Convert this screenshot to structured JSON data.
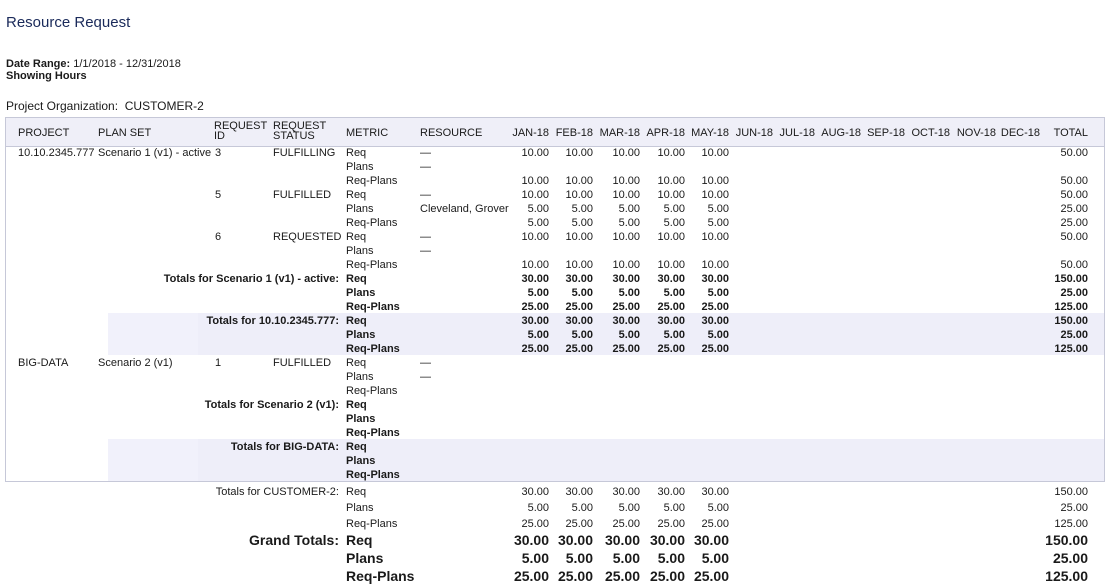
{
  "page": {
    "title": "Resource Request",
    "date_range_label": "Date Range:",
    "date_range_value": "1/1/2018 - 12/31/2018",
    "showing": "Showing Hours",
    "org_label": "Project Organization:",
    "org_value": "CUSTOMER-2"
  },
  "columns": {
    "project": "PROJECT",
    "plan_set": "PLAN SET",
    "request_id": [
      "REQUEST",
      "ID"
    ],
    "request_status": [
      "REQUEST",
      "STATUS"
    ],
    "metric": "METRIC",
    "resource": "RESOURCE",
    "months": [
      "JAN-18",
      "FEB-18",
      "MAR-18",
      "APR-18",
      "MAY-18",
      "JUN-18",
      "JUL-18",
      "AUG-18",
      "SEP-18",
      "OCT-18",
      "NOV-18",
      "DEC-18"
    ],
    "total": "TOTAL"
  },
  "rows": [
    {
      "kind": "data",
      "project": "10.10.2345.777",
      "plan_set": "Scenario 1 (v1) - active",
      "request_id": "3",
      "status": "FULFILLING",
      "metric": "Req",
      "resource": "—",
      "values": [
        "10.00",
        "10.00",
        "10.00",
        "10.00",
        "10.00"
      ],
      "total": "50.00"
    },
    {
      "kind": "data",
      "metric": "Plans",
      "resource": "—",
      "values": [],
      "total": ""
    },
    {
      "kind": "data",
      "metric": "Req-Plans",
      "values": [
        "10.00",
        "10.00",
        "10.00",
        "10.00",
        "10.00"
      ],
      "total": "50.00"
    },
    {
      "kind": "data",
      "request_id": "5",
      "status": "FULFILLED",
      "metric": "Req",
      "resource": "—",
      "values": [
        "10.00",
        "10.00",
        "10.00",
        "10.00",
        "10.00"
      ],
      "total": "50.00"
    },
    {
      "kind": "data",
      "metric": "Plans",
      "resource": "Cleveland, Grover",
      "values": [
        "5.00",
        "5.00",
        "5.00",
        "5.00",
        "5.00"
      ],
      "total": "25.00"
    },
    {
      "kind": "data",
      "metric": "Req-Plans",
      "values": [
        "5.00",
        "5.00",
        "5.00",
        "5.00",
        "5.00"
      ],
      "total": "25.00"
    },
    {
      "kind": "data",
      "request_id": "6",
      "status": "REQUESTED",
      "metric": "Req",
      "resource": "—",
      "values": [
        "10.00",
        "10.00",
        "10.00",
        "10.00",
        "10.00"
      ],
      "total": "50.00"
    },
    {
      "kind": "data",
      "metric": "Plans",
      "resource": "—",
      "values": [],
      "total": ""
    },
    {
      "kind": "data",
      "metric": "Req-Plans",
      "values": [
        "10.00",
        "10.00",
        "10.00",
        "10.00",
        "10.00"
      ],
      "total": "50.00"
    },
    {
      "kind": "total",
      "label": "Totals for Scenario 1 (v1) - active:",
      "metric": "Req",
      "values": [
        "30.00",
        "30.00",
        "30.00",
        "30.00",
        "30.00"
      ],
      "total": "150.00"
    },
    {
      "kind": "total",
      "metric": "Plans",
      "values": [
        "5.00",
        "5.00",
        "5.00",
        "5.00",
        "5.00"
      ],
      "total": "25.00"
    },
    {
      "kind": "total",
      "metric": "Req-Plans",
      "values": [
        "25.00",
        "25.00",
        "25.00",
        "25.00",
        "25.00"
      ],
      "total": "125.00"
    },
    {
      "kind": "total",
      "band": true,
      "label": "Totals for 10.10.2345.777:",
      "metric": "Req",
      "values": [
        "30.00",
        "30.00",
        "30.00",
        "30.00",
        "30.00"
      ],
      "total": "150.00"
    },
    {
      "kind": "total",
      "band": true,
      "metric": "Plans",
      "values": [
        "5.00",
        "5.00",
        "5.00",
        "5.00",
        "5.00"
      ],
      "total": "25.00"
    },
    {
      "kind": "total",
      "band": true,
      "metric": "Req-Plans",
      "values": [
        "25.00",
        "25.00",
        "25.00",
        "25.00",
        "25.00"
      ],
      "total": "125.00"
    },
    {
      "kind": "data",
      "project": "BIG-DATA",
      "plan_set": "Scenario 2 (v1)",
      "request_id": "1",
      "status": "FULFILLED",
      "metric": "Req",
      "resource": "—",
      "values": [],
      "total": ""
    },
    {
      "kind": "data",
      "metric": "Plans",
      "resource": "—",
      "values": [],
      "total": ""
    },
    {
      "kind": "data",
      "metric": "Req-Plans",
      "values": [],
      "total": ""
    },
    {
      "kind": "total",
      "label": "Totals for Scenario 2 (v1):",
      "metric": "Req",
      "values": [],
      "total": ""
    },
    {
      "kind": "total",
      "metric": "Plans",
      "values": [],
      "total": ""
    },
    {
      "kind": "total",
      "metric": "Req-Plans",
      "values": [],
      "total": ""
    },
    {
      "kind": "total",
      "band": true,
      "label": "Totals for BIG-DATA:",
      "metric": "Req",
      "values": [],
      "total": ""
    },
    {
      "kind": "total",
      "band": true,
      "metric": "Plans",
      "values": [],
      "total": ""
    },
    {
      "kind": "total",
      "band": true,
      "metric": "Req-Plans",
      "values": [],
      "total": ""
    }
  ],
  "org_totals": {
    "label": "Totals for CUSTOMER-2:",
    "rows": [
      {
        "metric": "Req",
        "values": [
          "30.00",
          "30.00",
          "30.00",
          "30.00",
          "30.00"
        ],
        "total": "150.00"
      },
      {
        "metric": "Plans",
        "values": [
          "5.00",
          "5.00",
          "5.00",
          "5.00",
          "5.00"
        ],
        "total": "25.00"
      },
      {
        "metric": "Req-Plans",
        "values": [
          "25.00",
          "25.00",
          "25.00",
          "25.00",
          "25.00"
        ],
        "total": "125.00"
      }
    ]
  },
  "grand_totals": {
    "label": "Grand Totals:",
    "rows": [
      {
        "metric": "Req",
        "values": [
          "30.00",
          "30.00",
          "30.00",
          "30.00",
          "30.00"
        ],
        "total": "150.00"
      },
      {
        "metric": "Plans",
        "values": [
          "5.00",
          "5.00",
          "5.00",
          "5.00",
          "5.00"
        ],
        "total": "25.00"
      },
      {
        "metric": "Req-Plans",
        "values": [
          "25.00",
          "25.00",
          "25.00",
          "25.00",
          "25.00"
        ],
        "total": "125.00"
      }
    ]
  },
  "colors": {
    "title": "#1a2a5a",
    "header_bg": "#efeff8",
    "band_bg": "#f1f1fb",
    "border": "#c6c8d8"
  }
}
